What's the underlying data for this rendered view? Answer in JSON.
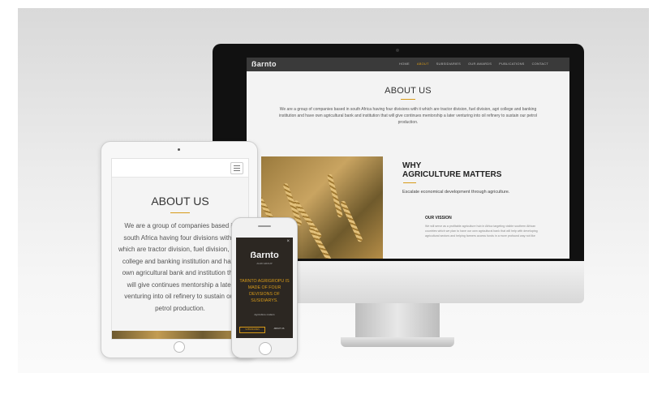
{
  "desktop": {
    "logo": "ẞarnto",
    "nav": [
      "HOME",
      "ABOUT",
      "SUBSIDIARIES",
      "OUR AWARDS",
      "PUBLICATIONS",
      "CONTACT"
    ],
    "active_nav": "ABOUT",
    "about_title": "ABOUT US",
    "about_text": "We are a group of companies based in south Africa having four divisions with it which are tractor division, fuel division, agri college and banking institution and have own agricultural bank and institution that will give continues mentorship a later venturing into oil refinery to sustain our petrol production.",
    "why_line1": "WHY",
    "why_line2": "AGRICULTURE MATTERS",
    "escalate": "Escalate economical development through agriculture.",
    "vision_title": "OUR VISSION",
    "vision_text": "We will serve as a profitable agriculture hub in Africa targeting visible southern African countries which we plan to have our own agricultural bank that will help with developing agricultural sectors and helping farmers access funds in a more profound way not like"
  },
  "tablet": {
    "about_title": "ABOUT US",
    "about_text": "We are a group of companies based in south Africa having four divisions with it which are tractor division, fuel division, agri college and banking institution and have own agricultural bank and institution that will give continues mentorship a later venturing into oil refinery to sustain our petrol production."
  },
  "phone": {
    "close": "×",
    "logo": "ẞarnto",
    "logo_sub": "agri group",
    "headline": "TARNTO AGRIGROPU IS MADE OF FOUR DEVISIONS OF SUSIDIARYS.",
    "tagline": "Agriculture matters",
    "primary_button": "SUBSIDIARIES",
    "secondary_button": "ABOUT US"
  },
  "colors": {
    "accent": "#d79a18",
    "nav_bg": "#3a3a3a",
    "phone_bg": "#2c2722"
  }
}
